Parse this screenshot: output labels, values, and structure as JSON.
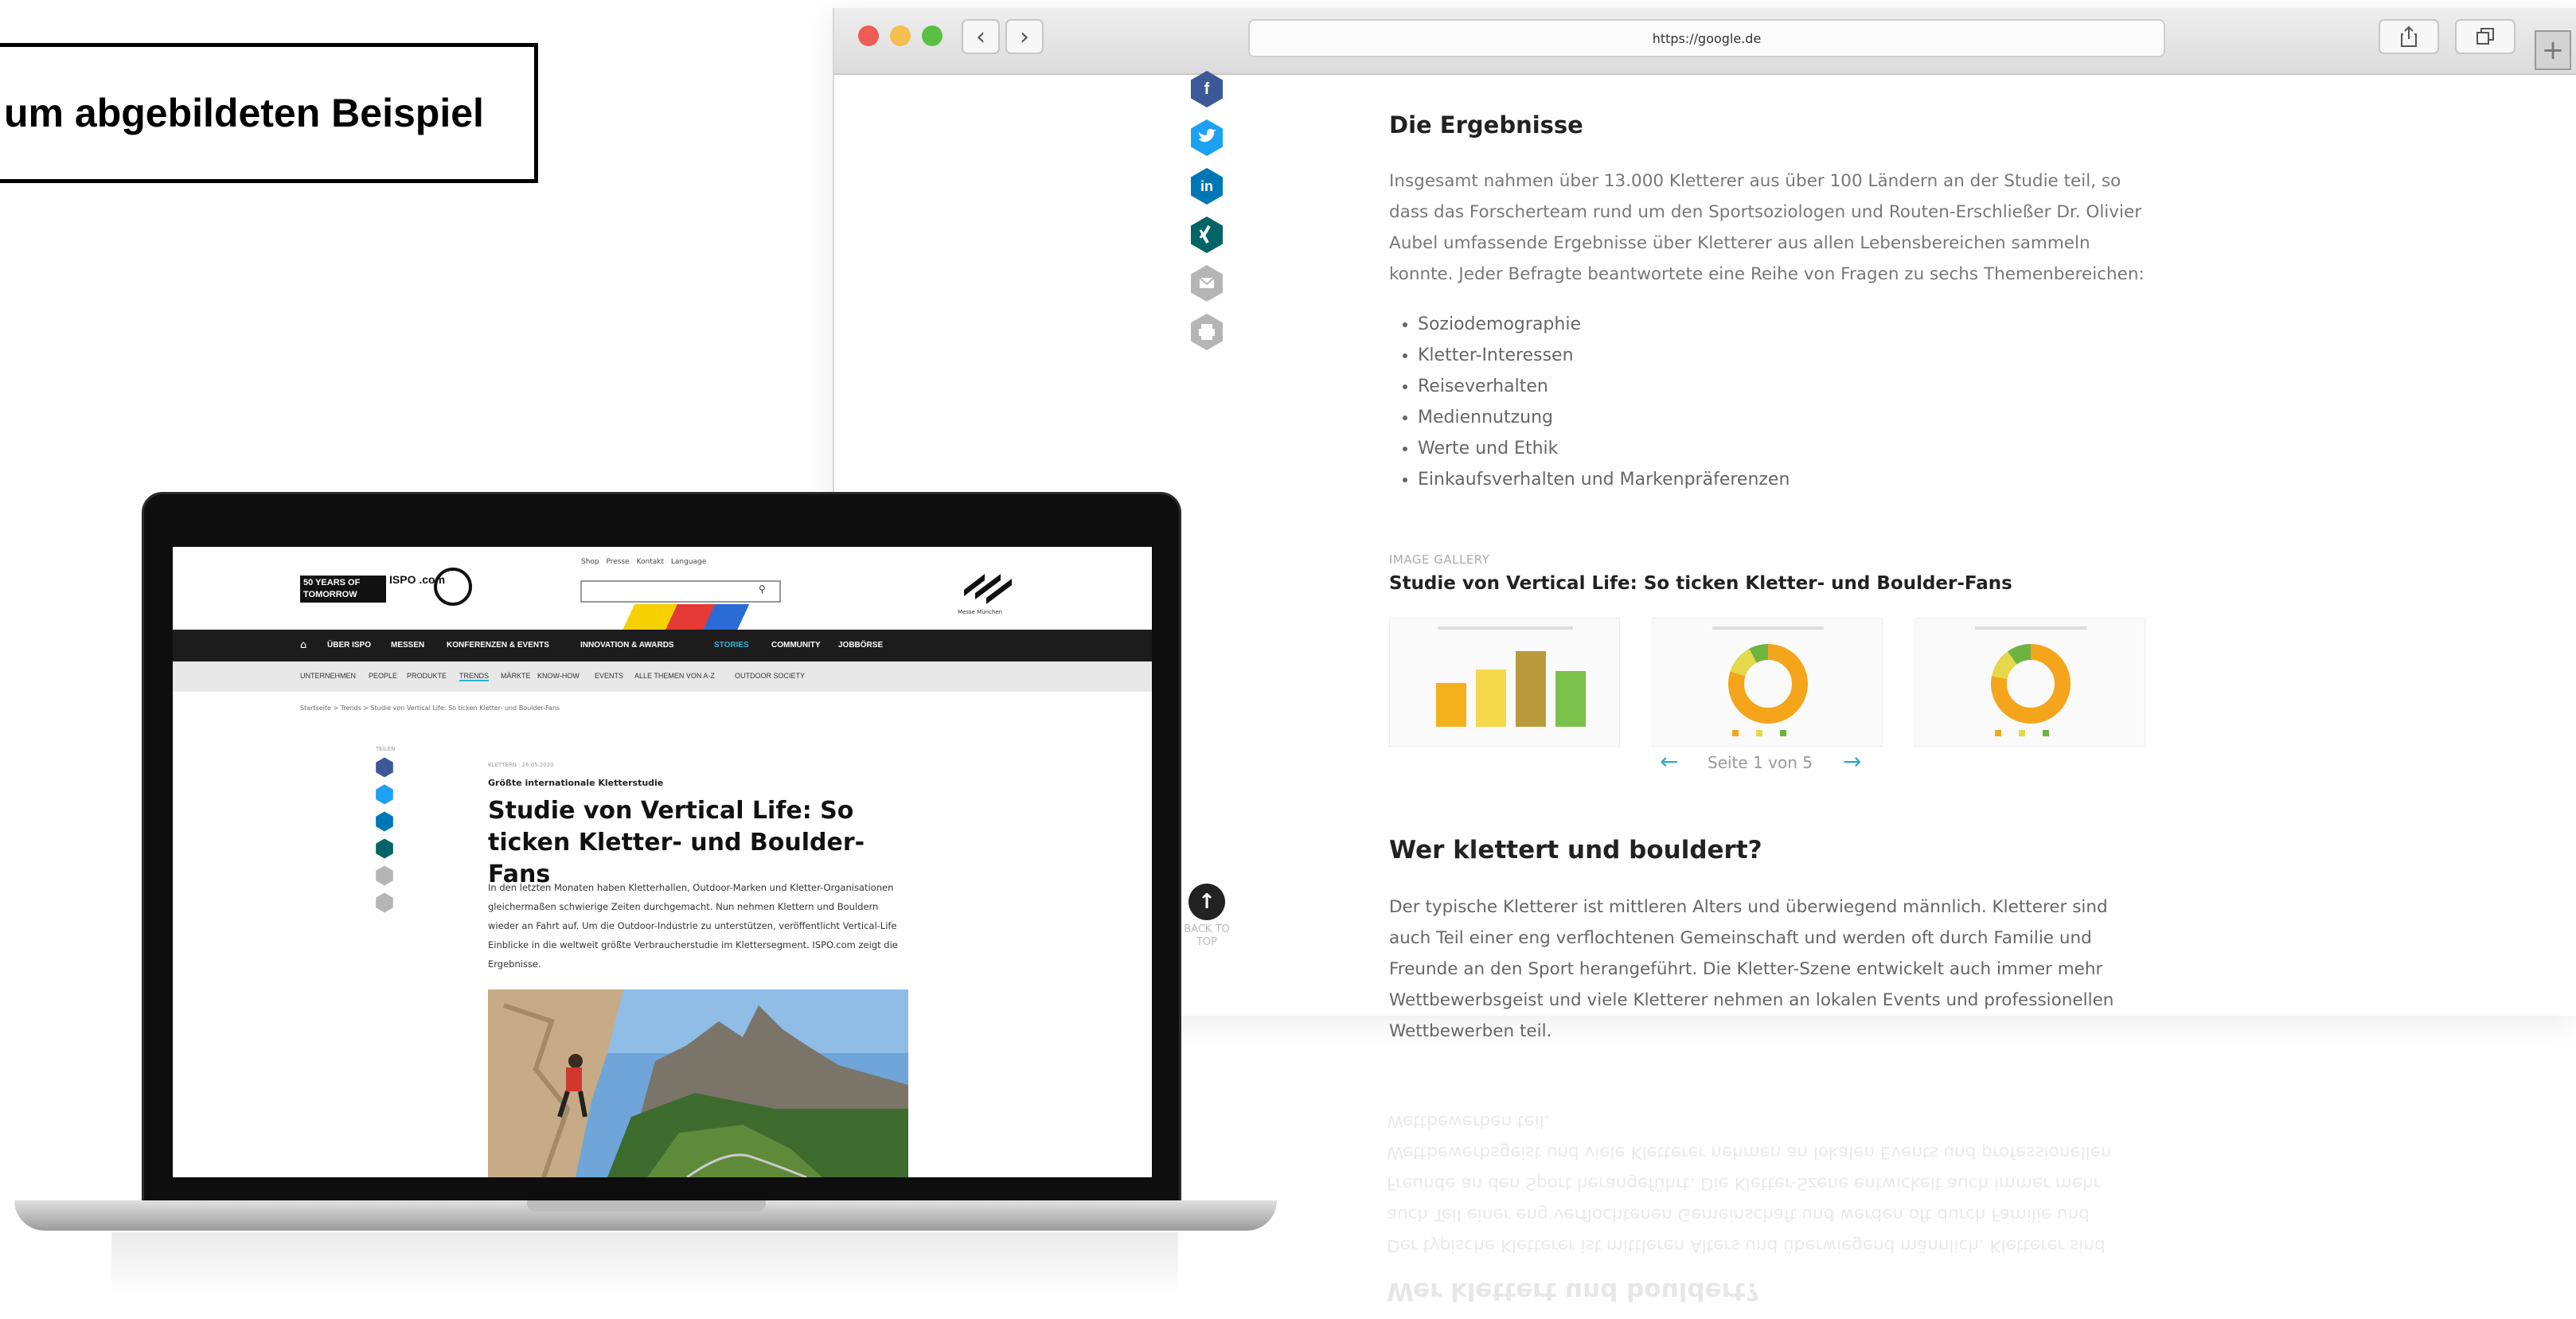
{
  "callout": {
    "text": "um abgebildeten Beispiel"
  },
  "browser": {
    "url": "https://google.de",
    "back_glyph": "‹",
    "forward_glyph": "›",
    "new_tab_glyph": "+"
  },
  "share_icons": [
    "facebook-icon",
    "twitter-icon",
    "linkedin-icon",
    "xing-icon",
    "mail-icon",
    "print-icon"
  ],
  "share_colors": [
    "#3b5998",
    "#1da1f2",
    "#0077b5",
    "#026466",
    "#b5b5b5",
    "#b5b5b5"
  ],
  "article": {
    "results_heading": "Die Ergebnisse",
    "results_paragraph": "Insgesamt nahmen über 13.000 Kletterer aus über 100 Ländern an der Studie teil, so dass das Forscherteam rund um den Sportsoziologen und Routen-Erschließer Dr. Olivier Aubel umfassende Ergebnisse über Kletterer aus allen Lebensbereichen sammeln konnte. Jeder Befragte beantwortete eine Reihe von Fragen zu sechs Themenbereichen:",
    "topics": [
      "Soziodemographie",
      "Kletter-Interessen",
      "Reiseverhalten",
      "Mediennutzung",
      "Werte und Ethik",
      "Einkaufsverhalten und Markenpräferenzen"
    ],
    "gallery_label": "IMAGE GALLERY",
    "gallery_title": "Studie von Vertical Life: So ticken Kletter- und Boulder-Fans",
    "pager_text": "Seite 1 von 5",
    "pager_prev": "←",
    "pager_next": "→",
    "who_heading": "Wer klettert und bouldert?",
    "who_paragraph": "Der typische Kletterer ist mittleren Alters und überwiegend männlich. Kletterer sind auch Teil einer eng verflochtenen Gemeinschaft und werden oft durch Familie und Freunde an den Sport herangeführt. Die Kletter-Szene entwickelt auch immer mehr Wettbewerbsgeist und viele Kletterer nehmen an lokalen Events und professionellen Wettbewerben teil.",
    "back_to_top": "BACK TO TOP",
    "back_to_top_glyph": "↑"
  },
  "gallery_thumbs": [
    {
      "type": "bar",
      "bar_colors": [
        "#f3b21c",
        "#f6d94a",
        "#b99a3c",
        "#7cc149"
      ],
      "values": [
        0.55,
        0.72,
        0.95,
        0.7
      ]
    },
    {
      "type": "donut",
      "colors": [
        "#f4a51c",
        "#e4d94a",
        "#6db33f"
      ],
      "values": [
        0.8,
        0.12,
        0.08
      ]
    },
    {
      "type": "donut",
      "colors": [
        "#f4a51c",
        "#e4d94a",
        "#6db33f"
      ],
      "values": [
        0.78,
        0.12,
        0.1
      ]
    }
  ],
  "laptop_site": {
    "logo_text": "50 YEARS OF TOMORROW",
    "logo_ispo": "ISPO .com",
    "top_links": "Shop Presse Kontakt Language",
    "search_glyph": "⚲",
    "messe_label": "Messe München",
    "home_glyph": "⌂",
    "nav": [
      "ÜBER ISPO",
      "MESSEN",
      "KONFERENZEN & EVENTS",
      "INNOVATION & AWARDS",
      "STORIES",
      "COMMUNITY",
      "JOBBÖRSE"
    ],
    "subnav": [
      "UNTERNEHMEN",
      "PEOPLE",
      "PRODUKTE",
      "TRENDS",
      "MÄRKTE",
      "KNOW-HOW",
      "EVENTS",
      "ALLE THEMEN VON A-Z",
      "OUTDOOR SOCIETY"
    ],
    "breadcrumb": "Startseite > Trends > Studie von Vertical Life: So ticken Kletter- und Boulder-Fans",
    "teilen": "TEILEN",
    "date": "KLETTERN · 26.05.2020",
    "kicker": "Größte internationale Kletterstudie",
    "title": "Studie von Vertical Life: So ticken Kletter- und Boulder-Fans",
    "lead": "In den letzten Monaten haben Kletterhallen, Outdoor-Marken und Kletter-Organisationen gleichermaßen schwierige Zeiten durchgemacht. Nun nehmen Klettern und Bouldern wieder an Fahrt auf. Um die Outdoor-Industrie zu unterstützen, veröffentlicht Vertical-Life Einblicke in die weltweit größte Verbraucherstudie im Klettersegment. ISPO.com zeigt die Ergebnisse."
  }
}
